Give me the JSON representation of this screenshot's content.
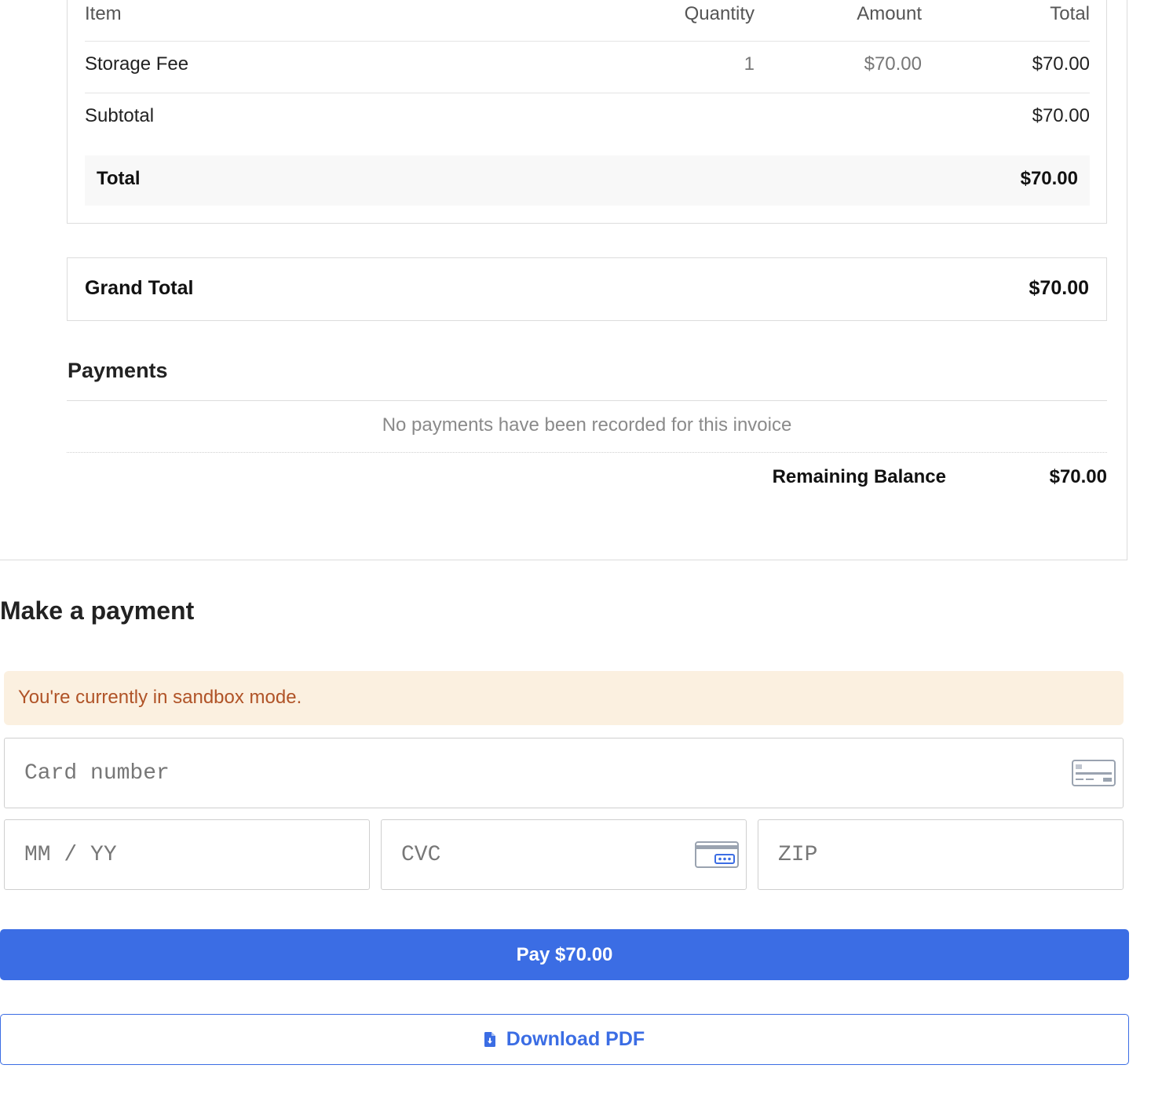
{
  "invoice": {
    "columns": {
      "item": "Item",
      "quantity": "Quantity",
      "amount": "Amount",
      "total": "Total"
    },
    "line_items": [
      {
        "item": "Storage Fee",
        "quantity": "1",
        "amount": "$70.00",
        "total": "$70.00"
      }
    ],
    "subtotal": {
      "label": "Subtotal",
      "value": "$70.00"
    },
    "total": {
      "label": "Total",
      "value": "$70.00"
    },
    "grand_total": {
      "label": "Grand Total",
      "value": "$70.00"
    }
  },
  "payments": {
    "title": "Payments",
    "empty_message": "No payments have been recorded for this invoice",
    "remaining_balance": {
      "label": "Remaining Balance",
      "value": "$70.00"
    }
  },
  "payment_form": {
    "title": "Make a payment",
    "sandbox_notice": "You're currently in sandbox mode.",
    "card_number_placeholder": "Card number",
    "expiry_placeholder": "MM / YY",
    "cvc_placeholder": "CVC",
    "zip_placeholder": "ZIP",
    "card_icon": "credit-card-icon",
    "cvc_icon": "card-back-icon",
    "pay_button_label": "Pay $70.00",
    "download_label": "Download PDF",
    "download_icon": "file-download-icon",
    "accent_color": "#3b6de4",
    "notice_bg_color": "#fbf0e0",
    "notice_text_color": "#b05327"
  }
}
